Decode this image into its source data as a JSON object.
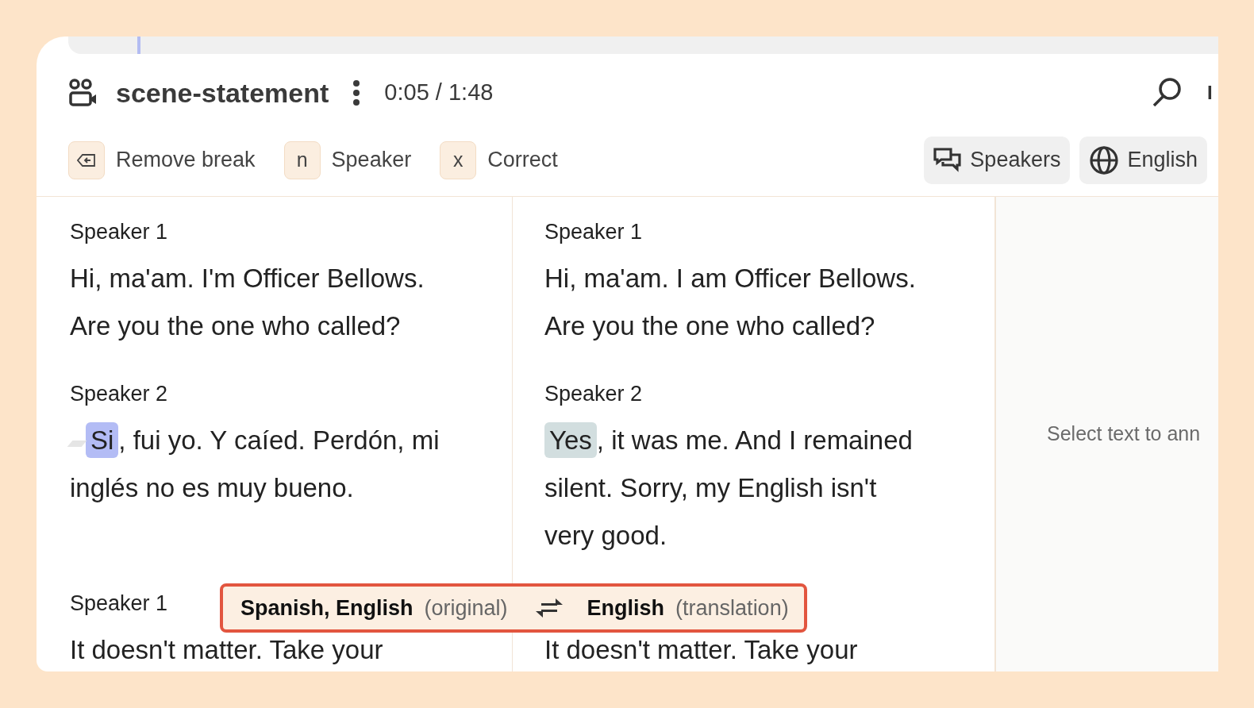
{
  "header": {
    "title": "scene-statement",
    "time": "0:05 / 1:48",
    "cut_label": "I"
  },
  "progress": {
    "level": 0.06
  },
  "shortcuts": [
    {
      "kind": "icon",
      "label": "Remove break"
    },
    {
      "kind": "key",
      "key": "n",
      "label": "Speaker"
    },
    {
      "kind": "key",
      "key": "x",
      "label": "Correct"
    }
  ],
  "buttons": [
    {
      "kind": "speakers",
      "label": "Speakers"
    },
    {
      "kind": "language",
      "label": "English"
    }
  ],
  "columns": [
    {
      "segments": [
        {
          "speaker": "Speaker 1",
          "marker": false,
          "lines": [
            [
              {
                "text": "Hi, ma'am. I'm Officer Bellows.",
                "highlighted": false,
                "selected": false
              }
            ],
            [
              {
                "text": "Are you the one who called?",
                "highlighted": false,
                "selected": false
              }
            ]
          ]
        },
        {
          "speaker": "Speaker 2",
          "marker": true,
          "lines": [
            [
              {
                "text": "Si",
                "highlighted": true,
                "selected": true
              },
              {
                "text": ", fui yo. Y caíed. Perdón, mi",
                "highlighted": false,
                "selected": false
              }
            ],
            [
              {
                "text": "inglés no es muy bueno.",
                "highlighted": false,
                "selected": false
              }
            ]
          ]
        },
        {
          "speaker": "Speaker 1",
          "marker": false,
          "lines": [
            [
              {
                "text": "It doesn't matter. Take your",
                "highlighted": false,
                "selected": false
              }
            ]
          ]
        }
      ]
    },
    {
      "segments": [
        {
          "speaker": "Speaker 1",
          "marker": false,
          "lines": [
            [
              {
                "text": "Hi, ma'am. I am Officer Bellows.",
                "highlighted": false,
                "selected": false
              }
            ],
            [
              {
                "text": "Are you the one who called?",
                "highlighted": false,
                "selected": false
              }
            ]
          ]
        },
        {
          "speaker": "Speaker 2",
          "marker": false,
          "lines": [
            [
              {
                "text": "Yes",
                "highlighted": true,
                "selected": false
              },
              {
                "text": ", it was me. And I remained",
                "highlighted": false,
                "selected": false
              }
            ],
            [
              {
                "text": "silent. Sorry, my English isn't",
                "highlighted": false,
                "selected": false
              }
            ],
            [
              {
                "text": "very good.",
                "highlighted": false,
                "selected": false
              }
            ]
          ]
        },
        {
          "marker": false,
          "lines": [
            [
              {
                "text": "It doesn't matter. Take your",
                "highlighted": false,
                "selected": false
              }
            ]
          ]
        }
      ]
    }
  ],
  "side_panel": {
    "hint": "Select text to ann"
  },
  "language_bar": {
    "source": "Spanish, English",
    "source_note": "(original)",
    "target": "English",
    "target_note": "(translation)"
  }
}
